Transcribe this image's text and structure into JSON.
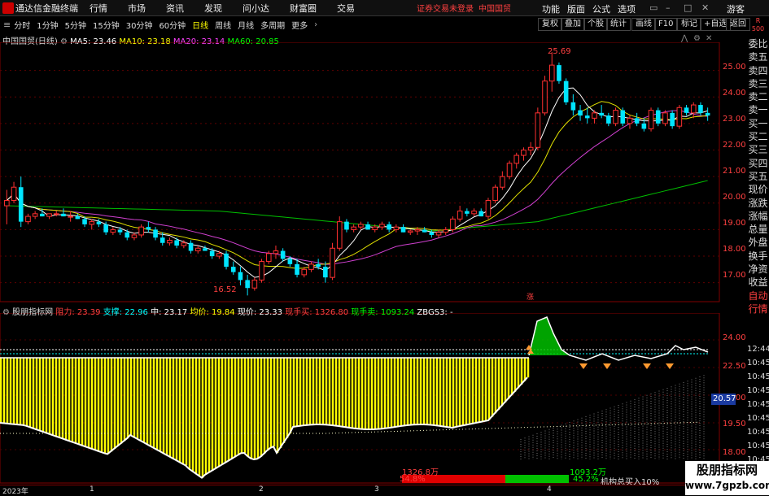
{
  "app": {
    "name": "通达信金融终端",
    "status": "证券交易未登录",
    "stock_title": "中国国贸"
  },
  "menus": [
    "行情",
    "市场",
    "资讯",
    "发现",
    "问小达",
    "财富圈",
    "交易"
  ],
  "right_menus": [
    "功能",
    "版面",
    "公式",
    "选项",
    "游客"
  ],
  "periods": {
    "items": [
      "分时",
      "1分钟",
      "5分钟",
      "15分钟",
      "30分钟",
      "60分钟",
      "日线",
      "周线",
      "月线",
      "多周期",
      "更多"
    ],
    "active": "日线"
  },
  "toolbar_buttons": [
    "复权",
    "叠加",
    "个股",
    "统计",
    "画线",
    "F10",
    "标记",
    "+自选",
    "返回"
  ],
  "main_chart": {
    "name": "中国国贸(日线)",
    "ma": [
      {
        "label": "MA5: 23.46",
        "color": "#ffffff"
      },
      {
        "label": "MA10: 23.18",
        "color": "#ffff00"
      },
      {
        "label": "MA20: 23.14",
        "color": "#ff40ff"
      },
      {
        "label": "MA60: 20.85",
        "color": "#00ff00"
      }
    ],
    "high_label": "25.69",
    "low_label": "16.52",
    "marker": "涨"
  },
  "right_panel": {
    "corner": "R",
    "corner_num": "500",
    "items": [
      "委比",
      "卖五",
      "卖四",
      "卖三",
      "卖二",
      "卖一",
      "买一",
      "买二",
      "买三",
      "买四",
      "买五",
      "现价",
      "涨跌",
      "涨幅",
      "总量",
      "外盘",
      "换手",
      "净资",
      "收益",
      "自动",
      "行情"
    ]
  },
  "indicator": {
    "name": "股朋指标网",
    "items": [
      {
        "label": "阻力: 23.39",
        "color": "#ff4040"
      },
      {
        "label": "支撑: 22.96",
        "color": "#00ffff"
      },
      {
        "label": "中: 23.17",
        "color": "#ffffff"
      },
      {
        "label": "均价: 19.84",
        "color": "#ffff00"
      },
      {
        "label": "现价: 23.33",
        "color": "#ffffff"
      },
      {
        "label": "现手买: 1326.80",
        "color": "#ff4040"
      },
      {
        "label": "现手卖: 1093.24",
        "color": "#00ff00"
      },
      {
        "label": "ZBGS3: -",
        "color": "#ffffff"
      }
    ],
    "box_value": "20.57",
    "buy_vol": "1326.8万",
    "sell_vol": "1093.2万",
    "buy_pct": "54.8%",
    "sell_pct": "45.2%",
    "inst_label": "机构总买入10%"
  },
  "axis": {
    "main_ticks": [
      "25.00",
      "24.00",
      "23.00",
      "22.00",
      "21.00",
      "20.00",
      "19.00",
      "18.00",
      "17.00"
    ],
    "ind_ticks": [
      "24.00",
      "22.50",
      "21.00",
      "19.50",
      "18.00"
    ],
    "right_times": [
      "12:44",
      "10:45",
      "10:45",
      "10:45",
      "10:45",
      "10:45",
      "10:45",
      "10:45",
      "10:45"
    ],
    "x_labels": [
      "2023年",
      "1",
      "2",
      "3",
      "4"
    ]
  },
  "chart_data": {
    "type": "candlestick",
    "title": "中国国贸(日线)",
    "candles": [
      [
        19.9,
        20.5,
        19.2,
        20.1
      ],
      [
        20.1,
        20.8,
        20.0,
        20.6
      ],
      [
        20.6,
        21.0,
        19.1,
        19.3
      ],
      [
        19.3,
        19.6,
        19.2,
        19.5
      ],
      [
        19.5,
        19.7,
        19.4,
        19.6
      ],
      [
        19.6,
        19.8,
        19.5,
        19.5
      ],
      [
        19.5,
        19.6,
        19.4,
        19.6
      ],
      [
        19.6,
        19.7,
        19.5,
        19.6
      ],
      [
        19.6,
        19.8,
        19.5,
        19.5
      ],
      [
        19.5,
        19.7,
        19.3,
        19.5
      ],
      [
        19.5,
        19.6,
        19.4,
        19.4
      ],
      [
        19.4,
        19.5,
        19.1,
        19.2
      ],
      [
        19.2,
        19.4,
        19.0,
        19.3
      ],
      [
        19.3,
        19.4,
        19.1,
        19.2
      ],
      [
        19.2,
        19.3,
        18.8,
        18.9
      ],
      [
        18.9,
        19.1,
        18.8,
        19.0
      ],
      [
        19.0,
        19.1,
        18.8,
        18.9
      ],
      [
        18.9,
        19.0,
        18.6,
        18.7
      ],
      [
        18.7,
        18.9,
        18.6,
        18.8
      ],
      [
        18.8,
        19.2,
        18.7,
        19.1
      ],
      [
        19.1,
        19.3,
        18.9,
        19.0
      ],
      [
        19.0,
        19.1,
        18.6,
        18.7
      ],
      [
        18.7,
        18.9,
        18.4,
        18.5
      ],
      [
        18.5,
        18.7,
        18.4,
        18.6
      ],
      [
        18.6,
        18.7,
        18.3,
        18.4
      ],
      [
        18.4,
        18.6,
        18.3,
        18.5
      ],
      [
        18.5,
        18.6,
        18.1,
        18.2
      ],
      [
        18.2,
        18.4,
        18.1,
        18.3
      ],
      [
        18.3,
        18.4,
        18.2,
        18.2
      ],
      [
        18.2,
        18.3,
        17.9,
        18.0
      ],
      [
        18.0,
        18.2,
        17.9,
        18.1
      ],
      [
        18.1,
        18.2,
        17.5,
        17.6
      ],
      [
        17.6,
        17.8,
        17.3,
        17.4
      ],
      [
        17.4,
        17.6,
        16.9,
        17.1
      ],
      [
        17.1,
        17.3,
        16.52,
        16.8
      ],
      [
        16.8,
        17.2,
        16.7,
        17.1
      ],
      [
        17.1,
        17.9,
        17.0,
        17.8
      ],
      [
        17.8,
        18.2,
        17.7,
        18.1
      ],
      [
        18.1,
        18.4,
        17.9,
        18.2
      ],
      [
        18.2,
        18.3,
        17.8,
        17.9
      ],
      [
        17.9,
        18.0,
        17.6,
        17.7
      ],
      [
        17.7,
        17.9,
        17.2,
        17.3
      ],
      [
        17.3,
        17.6,
        17.2,
        17.5
      ],
      [
        17.5,
        17.8,
        17.4,
        17.7
      ],
      [
        17.7,
        17.9,
        17.5,
        17.6
      ],
      [
        17.6,
        17.8,
        17.0,
        17.2
      ],
      [
        17.2,
        18.5,
        17.1,
        18.3
      ],
      [
        18.3,
        19.5,
        18.2,
        19.3
      ],
      [
        19.3,
        19.4,
        18.9,
        19.0
      ],
      [
        19.0,
        19.2,
        18.9,
        19.1
      ],
      [
        19.1,
        19.3,
        19.0,
        19.2
      ],
      [
        19.2,
        19.3,
        19.0,
        19.0
      ],
      [
        19.0,
        19.2,
        18.9,
        19.1
      ],
      [
        19.1,
        19.3,
        19.0,
        19.2
      ],
      [
        19.2,
        19.3,
        18.9,
        19.0
      ],
      [
        19.0,
        19.2,
        18.9,
        19.1
      ],
      [
        19.1,
        19.2,
        18.9,
        18.9
      ],
      [
        18.9,
        19.0,
        18.8,
        18.95
      ],
      [
        18.95,
        19.1,
        18.8,
        19.0
      ],
      [
        19.0,
        19.1,
        18.9,
        18.9
      ],
      [
        18.9,
        19.0,
        18.7,
        18.8
      ],
      [
        18.8,
        19.0,
        18.7,
        18.9
      ],
      [
        18.9,
        19.1,
        18.8,
        19.0
      ],
      [
        19.0,
        19.5,
        18.9,
        19.4
      ],
      [
        19.4,
        19.9,
        19.3,
        19.7
      ],
      [
        19.7,
        19.8,
        19.5,
        19.6
      ],
      [
        19.6,
        19.8,
        19.5,
        19.7
      ],
      [
        19.7,
        19.8,
        19.5,
        19.5
      ],
      [
        19.5,
        20.2,
        19.4,
        20.1
      ],
      [
        20.1,
        20.7,
        20.0,
        20.6
      ],
      [
        20.6,
        21.2,
        20.5,
        21.0
      ],
      [
        21.0,
        21.6,
        20.9,
        21.5
      ],
      [
        21.5,
        21.9,
        21.3,
        21.8
      ],
      [
        21.8,
        22.1,
        21.6,
        22.0
      ],
      [
        22.0,
        22.3,
        21.8,
        22.1
      ],
      [
        22.1,
        23.6,
        22.0,
        23.4
      ],
      [
        23.4,
        24.8,
        23.3,
        24.6
      ],
      [
        24.6,
        25.69,
        24.2,
        25.2
      ],
      [
        25.2,
        25.3,
        24.5,
        24.6
      ],
      [
        24.6,
        24.7,
        23.7,
        23.8
      ],
      [
        23.8,
        24.1,
        23.3,
        23.5
      ],
      [
        23.5,
        23.7,
        23.1,
        23.3
      ],
      [
        23.3,
        23.6,
        23.0,
        23.2
      ],
      [
        23.2,
        23.5,
        23.0,
        23.4
      ],
      [
        23.4,
        23.7,
        23.2,
        23.3
      ],
      [
        23.3,
        23.4,
        22.9,
        23.0
      ],
      [
        23.0,
        23.6,
        22.9,
        23.5
      ],
      [
        23.5,
        23.6,
        22.9,
        23.0
      ],
      [
        23.0,
        23.3,
        22.8,
        23.2
      ],
      [
        23.2,
        23.4,
        22.9,
        23.0
      ],
      [
        23.0,
        23.2,
        22.7,
        22.8
      ],
      [
        22.8,
        23.6,
        22.7,
        23.5
      ],
      [
        23.5,
        23.6,
        22.9,
        23.0
      ],
      [
        23.0,
        23.5,
        22.9,
        23.4
      ],
      [
        23.4,
        23.5,
        22.8,
        22.9
      ],
      [
        22.9,
        23.7,
        22.8,
        23.6
      ],
      [
        23.6,
        23.7,
        23.3,
        23.4
      ],
      [
        23.4,
        23.8,
        23.2,
        23.7
      ],
      [
        23.7,
        23.8,
        23.3,
        23.4
      ],
      [
        23.4,
        23.6,
        23.1,
        23.3
      ]
    ],
    "ma60": [
      [
        0,
        19.9
      ],
      [
        30,
        19.7
      ],
      [
        60,
        18.95
      ],
      [
        75,
        19.3
      ],
      [
        99,
        20.85
      ]
    ],
    "ylim": [
      16.5,
      26.0
    ]
  }
}
